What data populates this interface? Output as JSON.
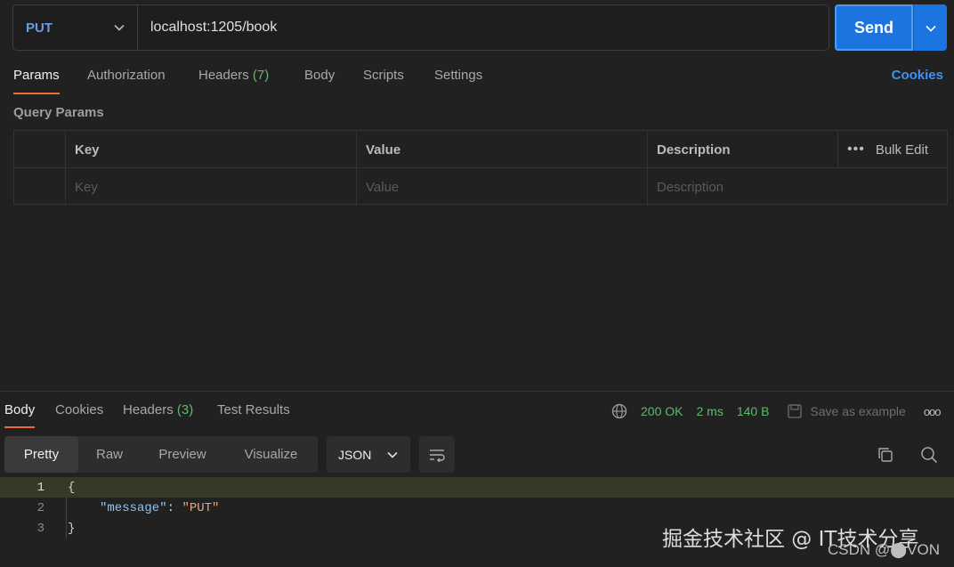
{
  "request": {
    "method": "PUT",
    "url": "localhost:1205/book",
    "send_label": "Send"
  },
  "request_tabs": {
    "params": "Params",
    "authorization": "Authorization",
    "headers": "Headers",
    "headers_count": "(7)",
    "body": "Body",
    "scripts": "Scripts",
    "settings": "Settings",
    "cookies": "Cookies"
  },
  "query_params": {
    "title": "Query Params",
    "columns": {
      "key": "Key",
      "value": "Value",
      "description": "Description"
    },
    "bulk_edit": "Bulk Edit",
    "more": "•••",
    "placeholders": {
      "key": "Key",
      "value": "Value",
      "description": "Description"
    }
  },
  "response": {
    "tabs": {
      "body": "Body",
      "cookies": "Cookies",
      "headers": "Headers",
      "headers_count": "(3)",
      "test_results": "Test Results"
    },
    "status": "200 OK",
    "time": "2 ms",
    "size": "140 B",
    "save_example": "Save as example",
    "more": "ooo",
    "views": [
      "Pretty",
      "Raw",
      "Preview",
      "Visualize"
    ],
    "format": "JSON",
    "code_lines": [
      {
        "n": "1",
        "text": "{"
      },
      {
        "n": "2",
        "key": "\"message\"",
        "sep": ": ",
        "value": "\"PUT\""
      },
      {
        "n": "3",
        "text": "}"
      }
    ]
  },
  "watermark": {
    "primary": "掘金技术社区 @ IT技术分享",
    "secondary": "CSDN @⬤VON"
  },
  "colors": {
    "accent": "#1b74e0",
    "tab_underline": "#ef6b3a",
    "success": "#5fb96c",
    "method": "#6a9be8"
  }
}
